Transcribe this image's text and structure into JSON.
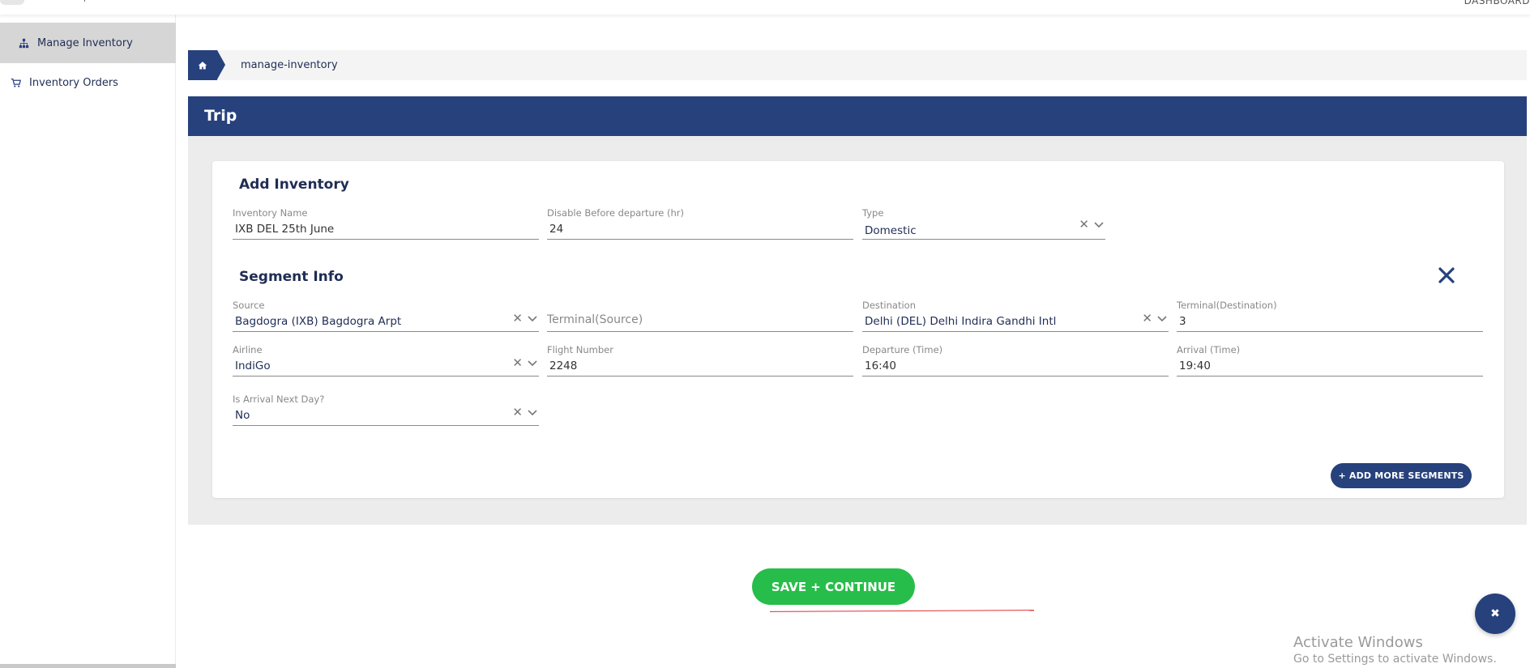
{
  "header": {
    "dashboard_label": "DASHBOARD"
  },
  "sidebar": {
    "items": [
      {
        "label": "Manage Inventory",
        "icon": "sitemap-icon",
        "active": true
      },
      {
        "label": "Inventory Orders",
        "icon": "cart-icon",
        "active": false
      }
    ]
  },
  "breadcrumb": {
    "home_icon": "home-icon",
    "current": "manage-inventory"
  },
  "trip": {
    "title": "Trip"
  },
  "add_inventory": {
    "title": "Add Inventory",
    "inventory_name": {
      "label": "Inventory Name",
      "value": "IXB DEL 25th June"
    },
    "disable_before": {
      "label": "Disable Before departure (hr)",
      "value": "24"
    },
    "type": {
      "label": "Type",
      "value": "Domestic"
    }
  },
  "segment_info": {
    "title": "Segment Info",
    "source": {
      "label": "Source",
      "value": "Bagdogra (IXB) Bagdogra Arpt"
    },
    "terminal_source": {
      "placeholder": "Terminal(Source)"
    },
    "destination": {
      "label": "Destination",
      "value": "Delhi (DEL) Delhi Indira Gandhi Intl"
    },
    "terminal_destination": {
      "label": "Terminal(Destination)",
      "value": "3"
    },
    "airline": {
      "label": "Airline",
      "value": "IndiGo"
    },
    "flight_number": {
      "label": "Flight Number",
      "value": "2248"
    },
    "departure_time": {
      "label": "Departure (Time)",
      "value": "16:40"
    },
    "arrival_time": {
      "label": "Arrival (Time)",
      "value": "19:40"
    },
    "arrival_next_day": {
      "label": "Is Arrival Next Day?",
      "value": "No"
    },
    "clear_glyph": "✕",
    "add_more_label": "+ ADD MORE SEGMENTS"
  },
  "actions": {
    "save_label": "SAVE + CONTINUE",
    "fab_close_glyph": "✖"
  },
  "watermark": {
    "line1": "Activate Windows",
    "line2": "Go to Settings to activate Windows."
  },
  "colors": {
    "primary": "#26417c",
    "success": "#27bd4a",
    "page_bg": "#ececec"
  }
}
